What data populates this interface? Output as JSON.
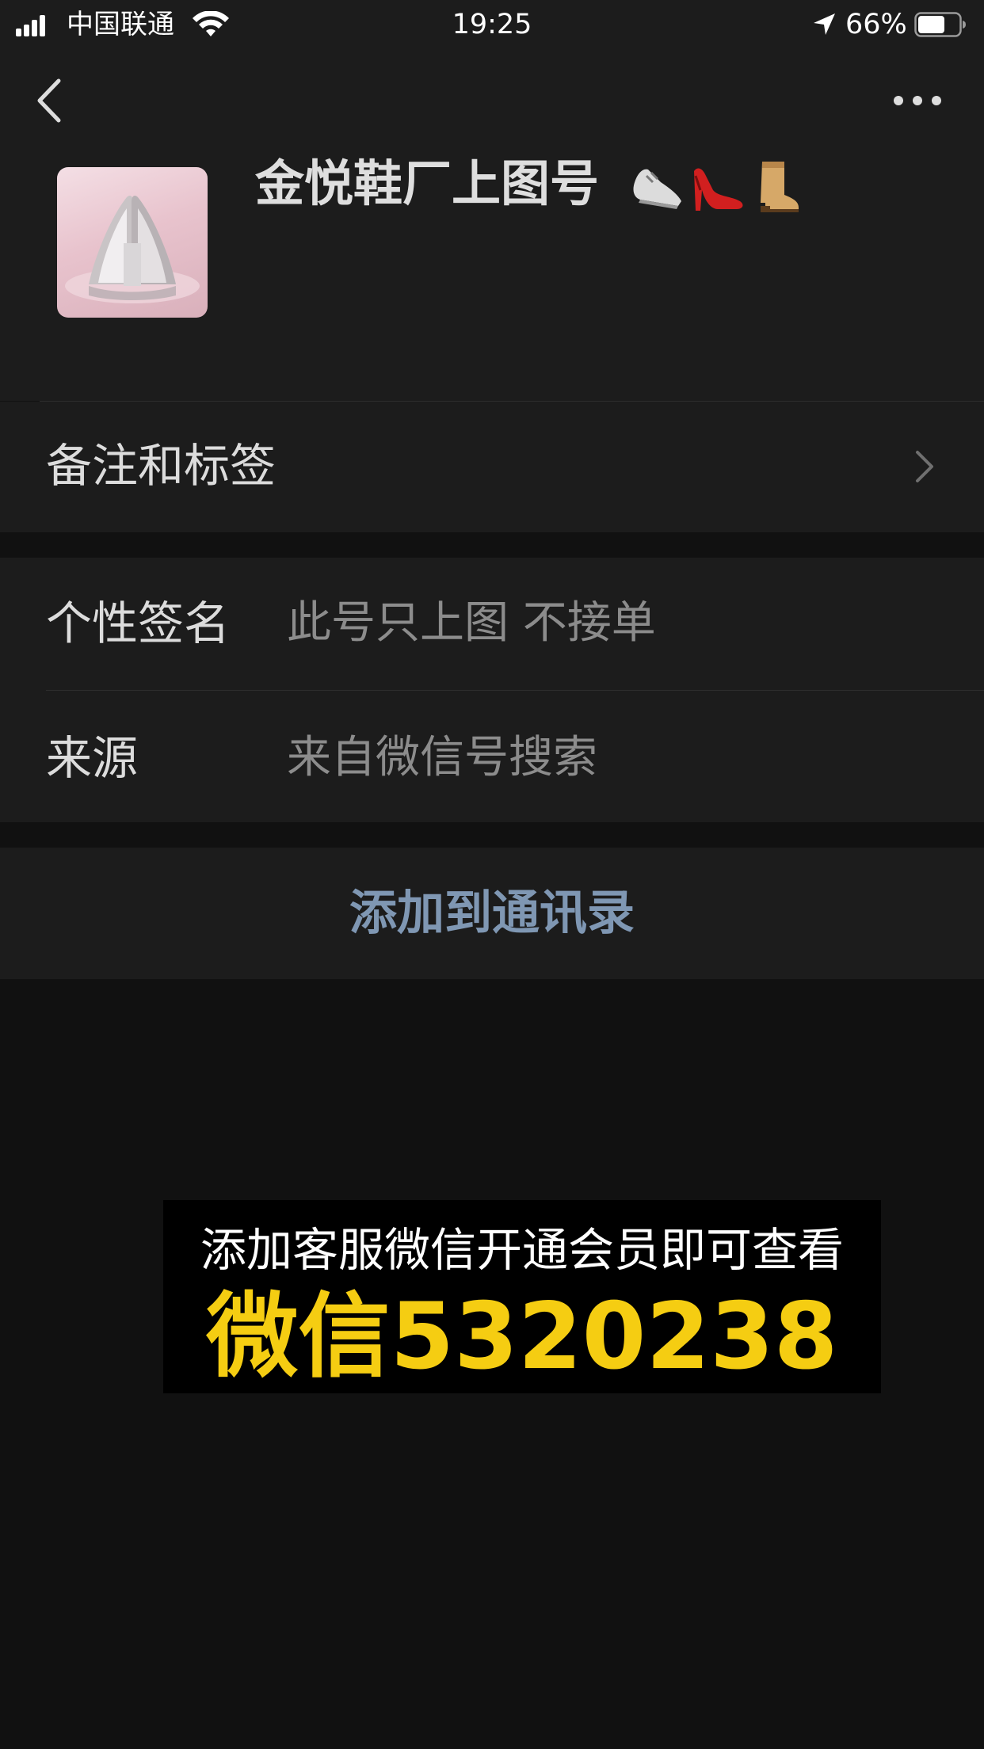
{
  "status_bar": {
    "carrier": "中国联通",
    "time": "19:25",
    "battery": "66%",
    "battery_level": 0.66,
    "icons": [
      "signal-icon",
      "wifi-icon",
      "location-arrow-icon",
      "battery-icon"
    ]
  },
  "nav": {
    "back_icon": "chevron-left-icon",
    "more_icon": "more-dots-icon"
  },
  "profile": {
    "name": "金悦鞋厂上图号",
    "avatar_icon": "high-heels-photo",
    "name_emojis": [
      "sneaker-emoji",
      "high-heel-emoji",
      "boot-emoji"
    ]
  },
  "rows": {
    "remark": {
      "label": "备注和标签"
    },
    "signature": {
      "label": "个性签名",
      "value": "此号只上图 不接单"
    },
    "source": {
      "label": "来源",
      "value": "来自微信号搜索"
    }
  },
  "actions": {
    "add_contact": "添加到通讯录"
  },
  "banner": {
    "line1": "添加客服微信开通会员即可查看",
    "line2": "微信5320238"
  },
  "colors": {
    "background": "#111111",
    "card": "#1c1c1c",
    "link": "#7f97b3",
    "banner_highlight": "#f5cd12"
  }
}
